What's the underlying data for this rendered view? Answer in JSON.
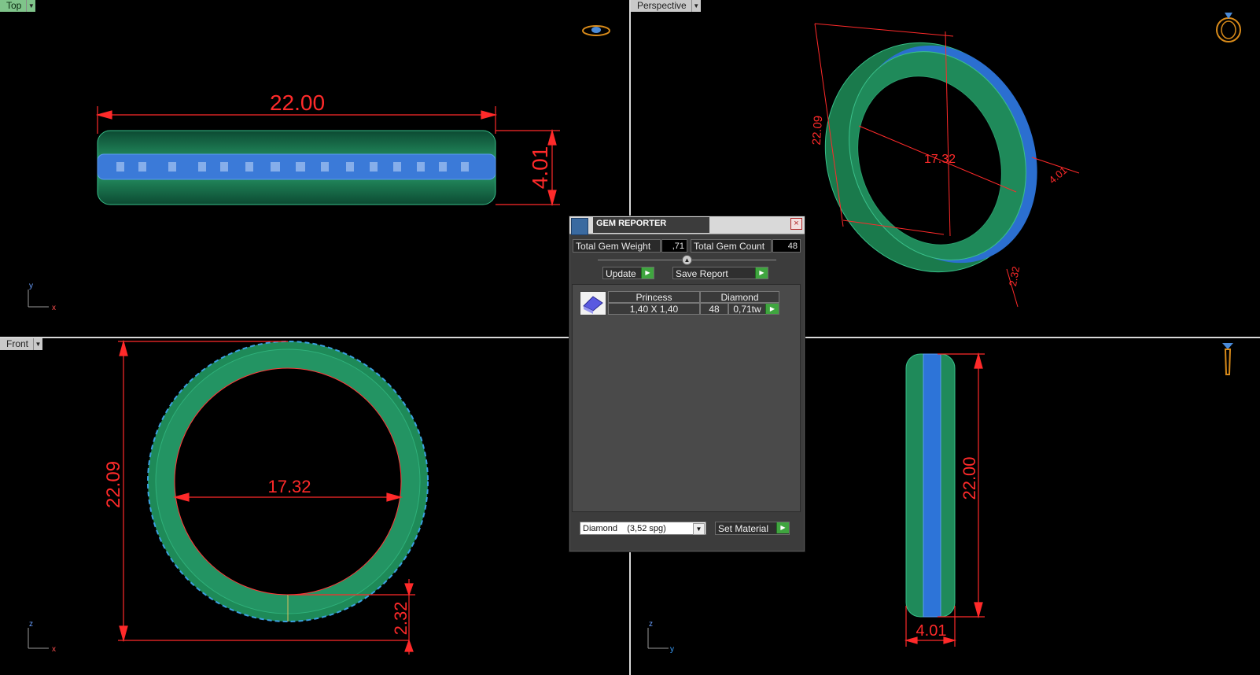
{
  "viewports": {
    "top": {
      "label": "Top"
    },
    "perspective": {
      "label": "Perspective"
    },
    "front": {
      "label": "Front"
    }
  },
  "dimensions": {
    "top_width": "22.00",
    "top_height": "4.01",
    "persp_outer": "22.09",
    "persp_inner": "17.32",
    "persp_width": "4.01",
    "persp_thick": "2.32",
    "front_outer": "22.09",
    "front_inner": "17.32",
    "front_thick": "2.32",
    "right_outer": "22.00",
    "right_width": "4.01"
  },
  "axes": {
    "top": {
      "v": "y",
      "h": "x"
    },
    "front": {
      "v": "z",
      "h": "x"
    },
    "right": {
      "v": "z",
      "h": "y"
    }
  },
  "gem_reporter": {
    "title": "GEM REPORTER",
    "close": "×",
    "total_weight_label": "Total Gem Weight",
    "total_weight_value": ",71",
    "total_count_label": "Total Gem Count",
    "total_count_value": "48",
    "update_label": "Update",
    "save_report_label": "Save Report",
    "gem_row": {
      "shape": "Princess",
      "material": "Diamond",
      "size": "1,40 X 1,40",
      "count": "48",
      "weight": "0,71tw"
    },
    "material_select": "Diamond    (3,52 spg)",
    "set_material_label": "Set Material"
  },
  "colors": {
    "dimension": "#ff2a2a",
    "metal": "#1f8a5a",
    "gems": "#3a78d8"
  }
}
